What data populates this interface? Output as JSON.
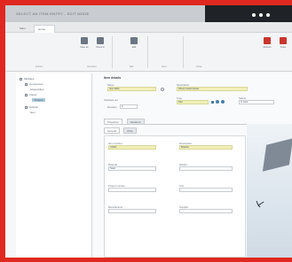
{
  "window": {
    "title": "SELECT AN ITEM ENTRY - EDIT MODE",
    "dots": [
      "•",
      "•",
      "•"
    ]
  },
  "tabs": [
    {
      "label": "Main"
    },
    {
      "label": "Home"
    }
  ],
  "ribbon": {
    "buttons": [
      {
        "label": "Save as",
        "icon": "save-icon"
      },
      {
        "label": "Check in",
        "icon": "check-in-icon"
      },
      {
        "label": "Edit",
        "icon": "edit-icon"
      },
      {
        "label": "Refresh",
        "icon": "refresh-icon"
      },
      {
        "label": "Close",
        "icon": "close-icon"
      }
    ],
    "groups": [
      "Actions",
      "Checkout",
      "Edit",
      "View",
      "Close"
    ]
  },
  "tree": {
    "items": [
      {
        "label": "Modules"
      },
      {
        "label": "Component"
      },
      {
        "label": "Assemblies"
      },
      {
        "label": "Import"
      },
      {
        "label": "Project"
      },
      {
        "label": "Archive"
      },
      {
        "label": "Item"
      }
    ]
  },
  "form": {
    "heading": "Item details",
    "name_label": "Name",
    "name_value": "Item-0001",
    "description_label": "Description",
    "description_value": "Sheet metal bracket",
    "type_label": "Type",
    "type_value": "Part",
    "status_label": "Status",
    "status_value": "In work",
    "revision_label": "Revision",
    "revision_value": "A",
    "checkbox_label": "Checked out",
    "subtabs": [
      "Properties",
      "Relations"
    ],
    "inner_tabs": [
      "General",
      "Other"
    ],
    "fields": [
      {
        "label": "Item number",
        "value": "I-0001"
      },
      {
        "label": "Description",
        "value": "Bracket"
      },
      {
        "label": "Material",
        "value": "Steel"
      },
      {
        "label": "Weight",
        "value": ""
      },
      {
        "label": "Project number",
        "value": ""
      },
      {
        "label": "Unit",
        "value": ""
      },
      {
        "label": "Manufacturer",
        "value": ""
      },
      {
        "label": "Supplier",
        "value": ""
      }
    ]
  },
  "colors": {
    "frame": "#e0281f",
    "accent": "#4a7fa6",
    "highlight": "#f0efb8"
  }
}
